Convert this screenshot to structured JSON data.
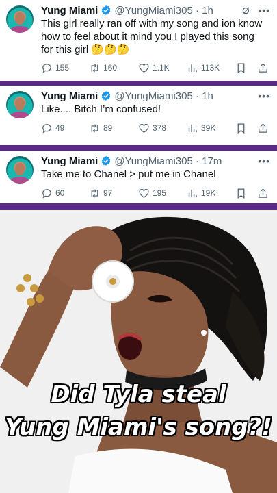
{
  "tweets": [
    {
      "name": "Yung Miami",
      "handle": "@YungMiami305 · 1h",
      "text": "This girl really ran off with my song and ion know how to feel about it mind you I played this song for this girl 🤔🤔🤔",
      "replies": "155",
      "retweets": "160",
      "likes": "1.1K",
      "views": "113K",
      "has_grok": true
    },
    {
      "name": "Yung Miami",
      "handle": "@YungMiami305 · 1h",
      "text": "Like.... Bitch I’m confused!",
      "replies": "49",
      "retweets": "89",
      "likes": "378",
      "views": "39K",
      "has_grok": false
    },
    {
      "name": "Yung Miami",
      "handle": "@YungMiami305 · 17m",
      "text": "Take me to Chanel > put me in Chanel",
      "replies": "60",
      "retweets": "97",
      "likes": "195",
      "views": "19K",
      "has_grok": false
    }
  ],
  "icons": {
    "verified": "verified-badge-icon",
    "more": "more-options-icon",
    "grok": "grok-icon",
    "reply": "reply-icon",
    "retweet": "retweet-icon",
    "like": "heart-icon",
    "views": "views-icon",
    "bookmark": "bookmark-icon",
    "share": "share-icon"
  },
  "colors": {
    "divider": "#5b2a86",
    "verified": "#1d9bf0",
    "muted": "#536471"
  },
  "caption": {
    "line1": "Did Tyla steal",
    "line2": "Yung Miami's song?!"
  }
}
